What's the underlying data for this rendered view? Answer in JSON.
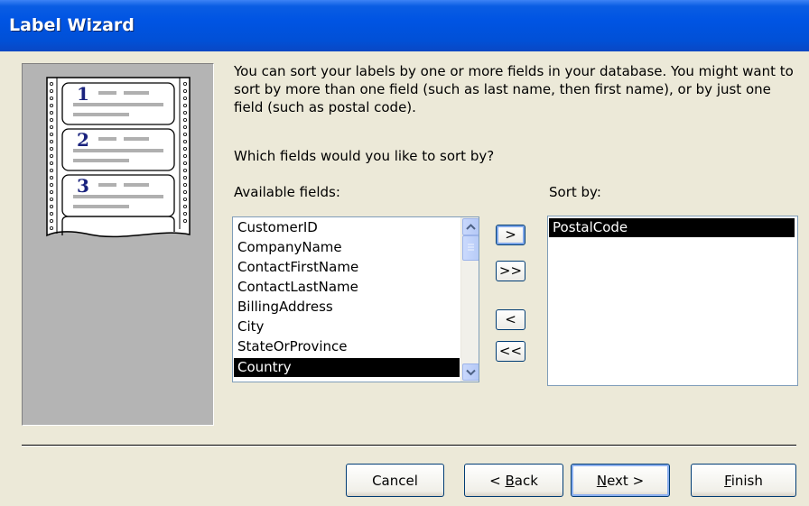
{
  "window": {
    "title": "Label Wizard"
  },
  "intro_text": "You can sort your labels by one or more fields in your database.  You might want to sort by more than one field (such as last name, then first name), or by just one field (such as postal code).",
  "question": "Which fields would you like to sort by?",
  "available": {
    "label": "Available fields:",
    "items": [
      "CustomerID",
      "CompanyName",
      "ContactFirstName",
      "ContactLastName",
      "BillingAddress",
      "City",
      "StateOrProvince",
      "Country"
    ],
    "selected": "Country"
  },
  "sort_by": {
    "label": "Sort by:",
    "items": [
      "PostalCode"
    ],
    "selected": "PostalCode"
  },
  "move_buttons": {
    "add_one": ">",
    "add_all": ">>",
    "remove_one": "<",
    "remove_all": "<<"
  },
  "illustration": {
    "numbers": [
      "1",
      "2",
      "3"
    ]
  },
  "footer": {
    "cancel": "Cancel",
    "back_prefix": "< ",
    "back_underline": "B",
    "back_rest": "ack",
    "next_underline": "N",
    "next_rest": "ext >",
    "finish_underline": "F",
    "finish_rest": "inish"
  },
  "colors": {
    "titlebar": "#0054e3",
    "dialog_bg": "#ece9d8",
    "selection": "#000000"
  }
}
